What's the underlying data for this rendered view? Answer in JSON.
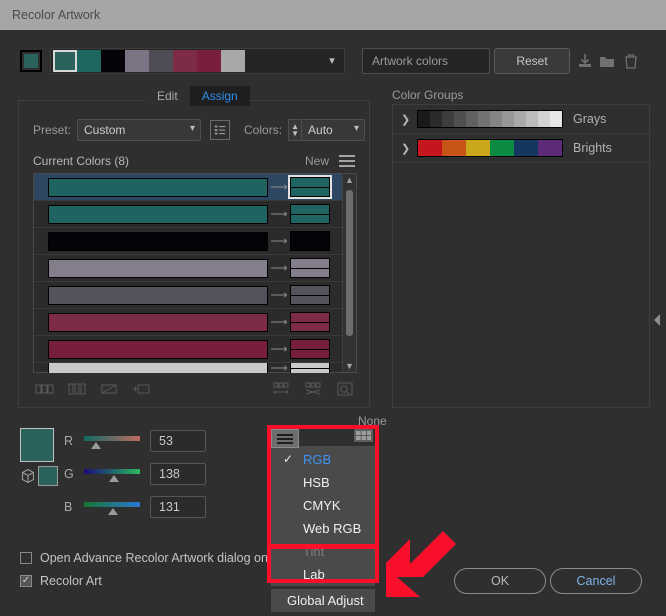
{
  "window": {
    "title": "Recolor Artwork"
  },
  "toolbar": {
    "swatch_strip": [
      "#2b625d",
      "#1e6660",
      "#050308",
      "#7c7485",
      "#4f4c55",
      "#7e2b46",
      "#791e3c",
      "#a8a8a8"
    ],
    "active_swatch": "#2b625d",
    "artwork_colors_label": "Artwork colors",
    "reset_label": "Reset",
    "icons": [
      "save-icon",
      "folder-icon",
      "trash-icon"
    ]
  },
  "tabs": [
    {
      "label": "Edit",
      "active": false
    },
    {
      "label": "Assign",
      "active": true
    }
  ],
  "preset": {
    "label": "Preset:",
    "value": "Custom",
    "list_icon": "list-view-icon"
  },
  "colors_control": {
    "label": "Colors:",
    "value": "Auto"
  },
  "current_colors": {
    "title": "Current Colors (8)",
    "new_label": "New",
    "menu_icon": "hamburger-icon",
    "rows": [
      {
        "current": "#1f6460",
        "new_top": "#1f6460",
        "new_bottom": "#1f6460",
        "selected": true
      },
      {
        "current": "#1f6460",
        "new_top": "#1f6460",
        "new_bottom": "#1f6460",
        "selected": false
      },
      {
        "current": "#050308",
        "new_top": "#050308",
        "new_bottom": "#050308",
        "selected": false
      },
      {
        "current": "#847d8c",
        "new_top": "#847d8c",
        "new_bottom": "#847d8c",
        "selected": false
      },
      {
        "current": "#56525c",
        "new_top": "#56525c",
        "new_bottom": "#56525c",
        "selected": false
      },
      {
        "current": "#7c2b47",
        "new_top": "#7c2b47",
        "new_bottom": "#7c2b47",
        "selected": false
      },
      {
        "current": "#761e3c",
        "new_top": "#761e3c",
        "new_bottom": "#761e3c",
        "selected": false
      },
      {
        "current": "#c9c9c9",
        "new_top": "#c9c9c9",
        "new_bottom": "#c9c9c9",
        "selected": false
      }
    ],
    "tools_left": [
      "merge-colors-icon",
      "separate-colors-icon",
      "exclude-colors-icon",
      "add-color-icon"
    ],
    "tools_right": [
      "randomize-order-icon",
      "randomize-saturation-icon",
      "color-reduction-options-icon"
    ]
  },
  "color_groups": {
    "title": "Color Groups",
    "items": [
      {
        "name": "Grays",
        "expander": "chevron-right-icon",
        "colors": [
          "#1a1a1a",
          "#2b2b2b",
          "#3d3d3d",
          "#4f4f4f",
          "#616161",
          "#737373",
          "#858585",
          "#979797",
          "#a9a9a9",
          "#bbbbbb",
          "#d2d2d2",
          "#e6e6e6"
        ]
      },
      {
        "name": "Brights",
        "expander": "chevron-right-icon",
        "colors": [
          "#c4161c",
          "#c75517",
          "#c9a91b",
          "#0a8a42",
          "#14375f",
          "#5c2a77"
        ]
      }
    ]
  },
  "panel_toggle": "collapse-panel-arrow-icon",
  "color_editor": {
    "none_label": "None",
    "preview_color": "#2b625d",
    "secondary_color": "#2b625d",
    "cube_icon": "global-color-cube-icon",
    "channels": [
      {
        "label": "R",
        "value": "53",
        "knob_pct": 21,
        "from": "#0f6a62",
        "to": "#c06a60"
      },
      {
        "label": "G",
        "value": "138",
        "knob_pct": 54,
        "from": "#1a0b7a",
        "to": "#2bbb5e"
      },
      {
        "label": "B",
        "value": "131",
        "knob_pct": 51,
        "from": "#13772f",
        "to": "#2b78d4"
      }
    ],
    "menu_button_icon": "hamburger-icon",
    "grid_icon": "color-grid-icon"
  },
  "color_mode_menu": {
    "items": [
      {
        "label": "RGB",
        "checked": true,
        "disabled": false
      },
      {
        "label": "HSB",
        "checked": false,
        "disabled": false
      },
      {
        "label": "CMYK",
        "checked": false,
        "disabled": false
      },
      {
        "label": "Web RGB",
        "checked": false,
        "disabled": false
      },
      {
        "label": "Tint",
        "checked": false,
        "disabled": true
      },
      {
        "label": "Lab",
        "checked": false,
        "disabled": false
      }
    ],
    "global_adjust": "Global Adjust",
    "highlight_color": "#fa0f2a",
    "check_glyph": "✓"
  },
  "footer": {
    "checkboxes": [
      {
        "label": "Open Advance Recolor Artwork dialog on la",
        "checked": false
      },
      {
        "label": "Recolor Art",
        "checked": true
      }
    ],
    "ok_label": "OK",
    "cancel_label": "Cancel"
  },
  "annotation": {
    "arrow": "red-arrow-pointing-down-left",
    "color": "#fa0f2a"
  }
}
